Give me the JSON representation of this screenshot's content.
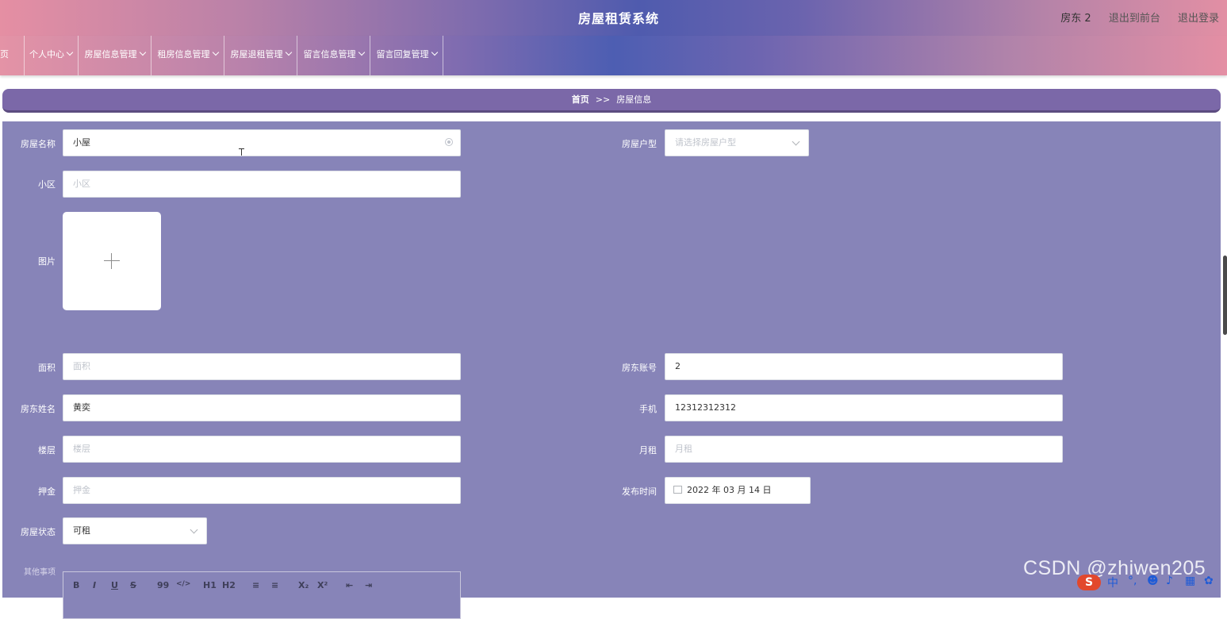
{
  "header": {
    "title": "房屋租赁系统",
    "user": "房东 2",
    "links": [
      "退出到前台",
      "退出登录"
    ]
  },
  "nav": {
    "items": [
      "页",
      "个人中心",
      "房屋信息管理",
      "租房信息管理",
      "房屋退租管理",
      "留言信息管理",
      "留言回复管理"
    ]
  },
  "breadcrumb": {
    "home": "首页",
    "separator": ">>",
    "current": "房屋信息"
  },
  "form": {
    "house_name": {
      "label": "房屋名称",
      "value": "小屋"
    },
    "house_type": {
      "label": "房屋户型",
      "placeholder": "请选择房屋户型"
    },
    "community": {
      "label": "小区",
      "placeholder": "小区"
    },
    "image": {
      "label": "图片"
    },
    "area": {
      "label": "面积",
      "placeholder": "面积"
    },
    "landlord_account": {
      "label": "房东账号",
      "value": "2"
    },
    "landlord_name": {
      "label": "房东姓名",
      "value": "黄奕"
    },
    "phone": {
      "label": "手机",
      "value": "12312312312"
    },
    "floor": {
      "label": "楼层",
      "placeholder": "楼层"
    },
    "monthly_rent": {
      "label": "月租",
      "placeholder": "月租"
    },
    "deposit": {
      "label": "押金",
      "placeholder": "押金"
    },
    "publish_time": {
      "label": "发布时间",
      "value": "2022 年 03 月 14 日"
    },
    "status": {
      "label": "房屋状态",
      "value": "可租"
    },
    "other": {
      "label": "其他事项"
    }
  },
  "editor_toolbar": [
    "B",
    "I",
    "U",
    "S",
    "99",
    "</>",
    "H1",
    "H2",
    "≡",
    "≡",
    "X₂",
    "X²",
    "⇤",
    "⇥"
  ],
  "watermark": "CSDN @zhiwen205",
  "ime": {
    "logo": "S",
    "mode": "中"
  },
  "colors": {
    "panel": "#8784b8",
    "breadcrumb": "#7b68a8"
  }
}
